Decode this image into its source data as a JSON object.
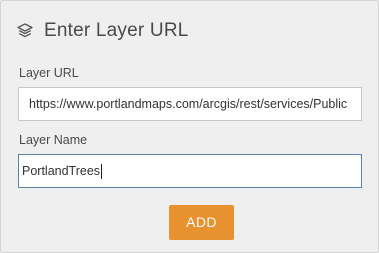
{
  "header": {
    "icon": "layers-icon",
    "title": "Enter Layer URL"
  },
  "layer_url": {
    "label": "Layer URL",
    "value": "https://www.portlandmaps.com/arcgis/rest/services/Public"
  },
  "layer_name": {
    "label": "Layer Name",
    "value": "PortlandTrees"
  },
  "add_button": {
    "label": "ADD",
    "color": "#e8922f"
  }
}
